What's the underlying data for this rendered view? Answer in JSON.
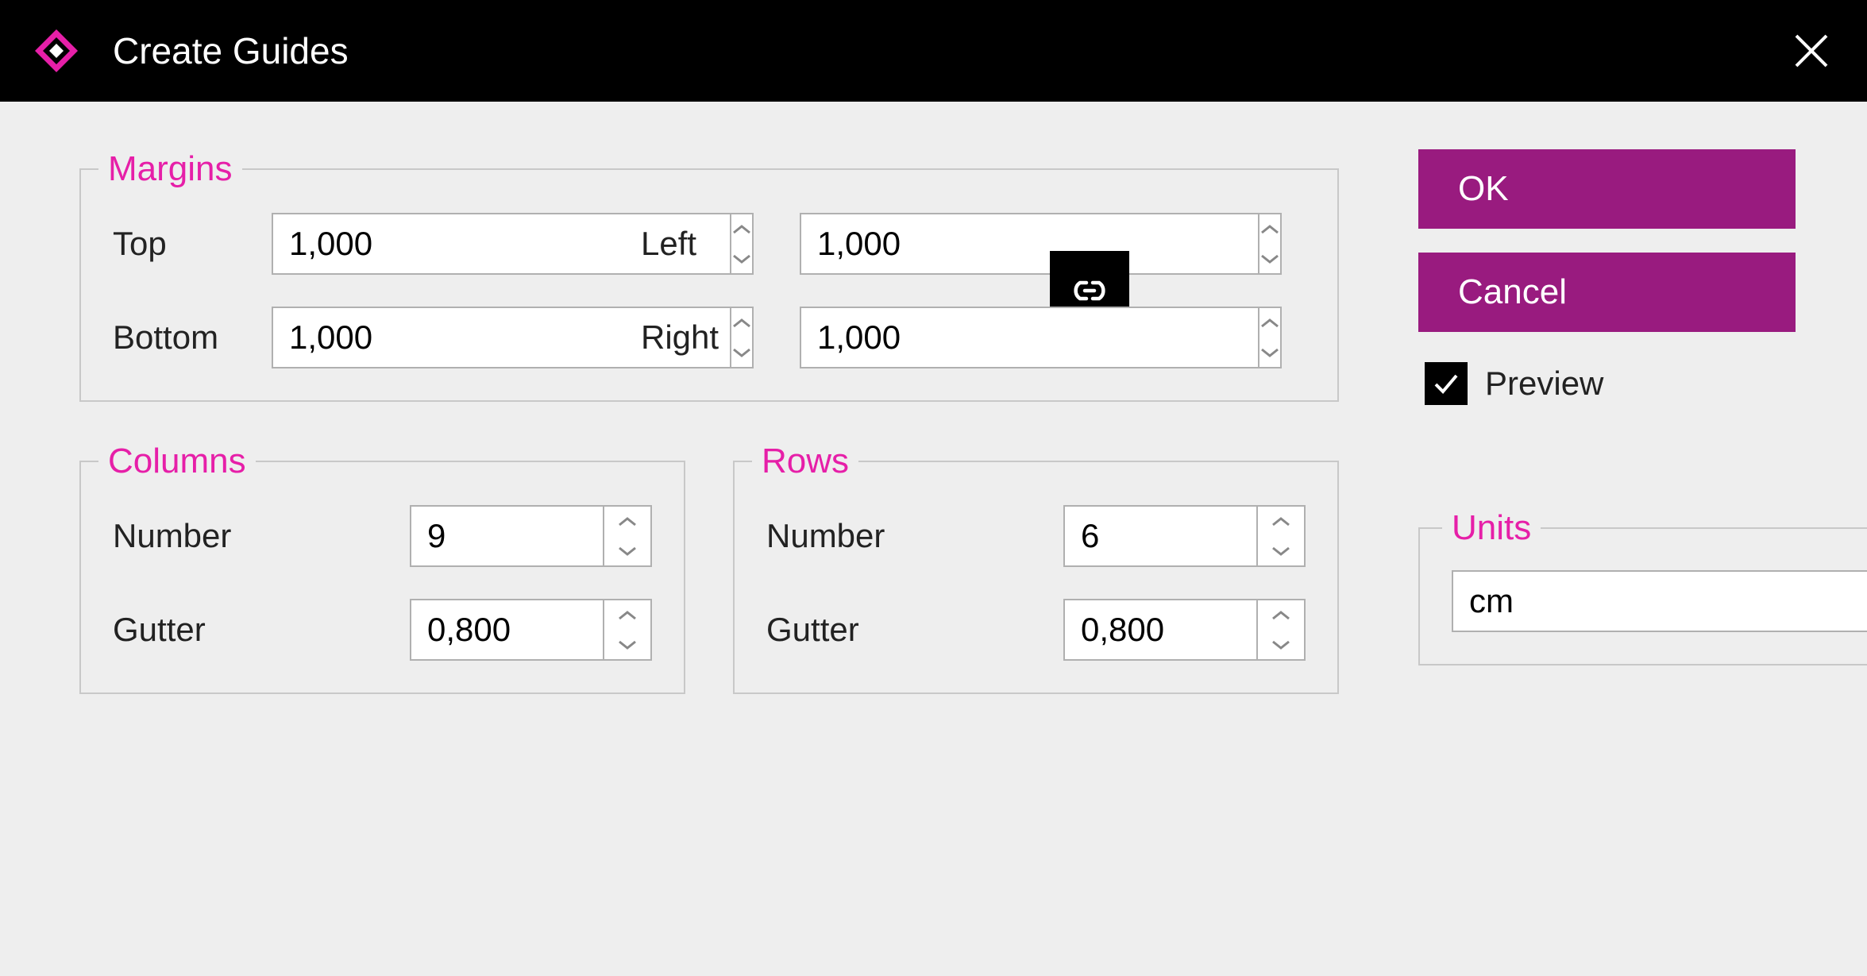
{
  "window": {
    "title": "Create Guides"
  },
  "margins": {
    "legend": "Margins",
    "top_label": "Top",
    "top_value": "1,000",
    "bottom_label": "Bottom",
    "bottom_value": "1,000",
    "left_label": "Left",
    "left_value": "1,000",
    "right_label": "Right",
    "right_value": "1,000"
  },
  "columns": {
    "legend": "Columns",
    "number_label": "Number",
    "number_value": "9",
    "gutter_label": "Gutter",
    "gutter_value": "0,800"
  },
  "rows": {
    "legend": "Rows",
    "number_label": "Number",
    "number_value": "6",
    "gutter_label": "Gutter",
    "gutter_value": "0,800"
  },
  "actions": {
    "ok_label": "OK",
    "cancel_label": "Cancel",
    "preview_label": "Preview",
    "preview_checked": true
  },
  "units": {
    "legend": "Units",
    "value": "cm"
  }
}
